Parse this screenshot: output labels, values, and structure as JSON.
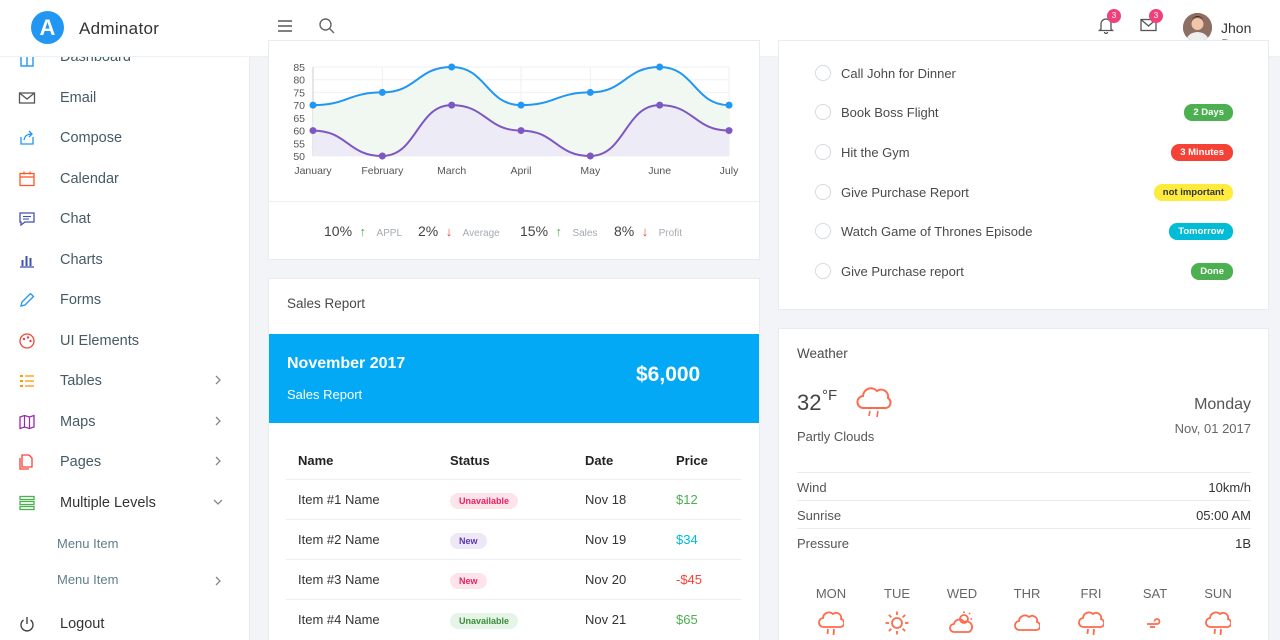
{
  "brand": {
    "logo_letter": "A",
    "name": "Adminator"
  },
  "sidebar": {
    "items": [
      {
        "label": "Dashboard",
        "icon": "home-icon",
        "color": "#2196f3"
      },
      {
        "label": "Email",
        "icon": "mail-icon",
        "color": "#555555"
      },
      {
        "label": "Compose",
        "icon": "share-icon",
        "color": "#2196f3"
      },
      {
        "label": "Calendar",
        "icon": "calendar-icon",
        "color": "#ff5722"
      },
      {
        "label": "Chat",
        "icon": "chat-icon",
        "color": "#3f51b5"
      },
      {
        "label": "Charts",
        "icon": "bar-chart-icon",
        "color": "#3f51b5"
      },
      {
        "label": "Forms",
        "icon": "pencil-icon",
        "color": "#2196f3"
      },
      {
        "label": "UI Elements",
        "icon": "palette-icon",
        "color": "#f44336"
      },
      {
        "label": "Tables",
        "icon": "list-icon",
        "color": "#ff9800"
      },
      {
        "label": "Maps",
        "icon": "map-icon",
        "color": "#9c27b0"
      },
      {
        "label": "Pages",
        "icon": "files-icon",
        "color": "#f44336"
      },
      {
        "label": "Multiple Levels",
        "icon": "layers-icon",
        "color": "#4caf50"
      }
    ],
    "sub_items": [
      "Menu Item",
      "Menu Item"
    ],
    "logout": "Logout"
  },
  "header": {
    "notifications_count": "3",
    "messages_count": "3",
    "user_name": "Jhon Doe"
  },
  "chart_data": {
    "type": "line",
    "categories": [
      "January",
      "February",
      "March",
      "April",
      "May",
      "June",
      "July"
    ],
    "ylim": [
      50,
      85
    ],
    "yticks": [
      "85",
      "80",
      "75",
      "70",
      "65",
      "60",
      "55",
      "50"
    ],
    "series": [
      {
        "name": "",
        "color": "#2196f3",
        "fill": "#eef7ef",
        "values": [
          70,
          75,
          85,
          70,
          75,
          85,
          70
        ]
      },
      {
        "name": "",
        "color": "#7e57c2",
        "fill": "#ece9f5",
        "values": [
          60,
          50,
          70,
          60,
          50,
          70,
          60
        ]
      }
    ]
  },
  "stats": [
    {
      "value": "10%",
      "dir": "up",
      "label": "APPL"
    },
    {
      "value": "2%",
      "dir": "down",
      "label": "Average"
    },
    {
      "value": "15%",
      "dir": "up",
      "label": "Sales"
    },
    {
      "value": "8%",
      "dir": "down",
      "label": "Profit"
    }
  ],
  "sales": {
    "title": "Sales Report",
    "banner_month": "November 2017",
    "banner_sub": "Sales Report",
    "banner_total": "$6,000",
    "columns": [
      "Name",
      "Status",
      "Date",
      "Price"
    ],
    "rows": [
      {
        "name": "Item #1 Name",
        "status": "Unavailable",
        "status_bg": "#fde4ea",
        "status_fg": "#e91e63",
        "date": "Nov 18",
        "price": "$12",
        "price_color": "#4caf50"
      },
      {
        "name": "Item #2 Name",
        "status": "New",
        "status_bg": "#ede7f6",
        "status_fg": "#5e35b1",
        "date": "Nov 19",
        "price": "$34",
        "price_color": "#00bcd4"
      },
      {
        "name": "Item #3 Name",
        "status": "New",
        "status_bg": "#fde4ea",
        "status_fg": "#e91e63",
        "date": "Nov 20",
        "price": "-$45",
        "price_color": "#f44336"
      },
      {
        "name": "Item #4 Name",
        "status": "Unavailable",
        "status_bg": "#e6f4e7",
        "status_fg": "#388e3c",
        "date": "Nov 21",
        "price": "$65",
        "price_color": "#4caf50"
      }
    ]
  },
  "todo": {
    "items": [
      {
        "text": "Call John for Dinner",
        "tag": "",
        "tag_bg": "",
        "tag_fg": ""
      },
      {
        "text": "Book Boss Flight",
        "tag": "2 Days",
        "tag_bg": "#4caf50",
        "tag_fg": "#ffffff"
      },
      {
        "text": "Hit the Gym",
        "tag": "3 Minutes",
        "tag_bg": "#f44336",
        "tag_fg": "#ffffff"
      },
      {
        "text": "Give Purchase Report",
        "tag": "not important",
        "tag_bg": "#ffeb3b",
        "tag_fg": "#333333"
      },
      {
        "text": "Watch Game of Thrones Episode",
        "tag": "Tomorrow",
        "tag_bg": "#00bcd4",
        "tag_fg": "#ffffff"
      },
      {
        "text": "Give Purchase report",
        "tag": "Done",
        "tag_bg": "#4caf50",
        "tag_fg": "#ffffff"
      }
    ]
  },
  "weather": {
    "title": "Weather",
    "temp": "32",
    "unit": "°F",
    "condition": "Partly Clouds",
    "day": "Monday",
    "date": "Nov, 01 2017",
    "details": [
      {
        "label": "Wind",
        "value": "10km/h"
      },
      {
        "label": "Sunrise",
        "value": "05:00 AM"
      },
      {
        "label": "Pressure",
        "value": "1B"
      }
    ],
    "days": [
      {
        "label": "MON",
        "icon": "rain-icon"
      },
      {
        "label": "TUE",
        "icon": "sun-icon"
      },
      {
        "label": "WED",
        "icon": "partly-cloudy-icon"
      },
      {
        "label": "THR",
        "icon": "cloud-icon"
      },
      {
        "label": "FRI",
        "icon": "rain-icon"
      },
      {
        "label": "SAT",
        "icon": "wind-icon"
      },
      {
        "label": "SUN",
        "icon": "rain-icon"
      }
    ],
    "icon_color": "#ff6a4c"
  }
}
